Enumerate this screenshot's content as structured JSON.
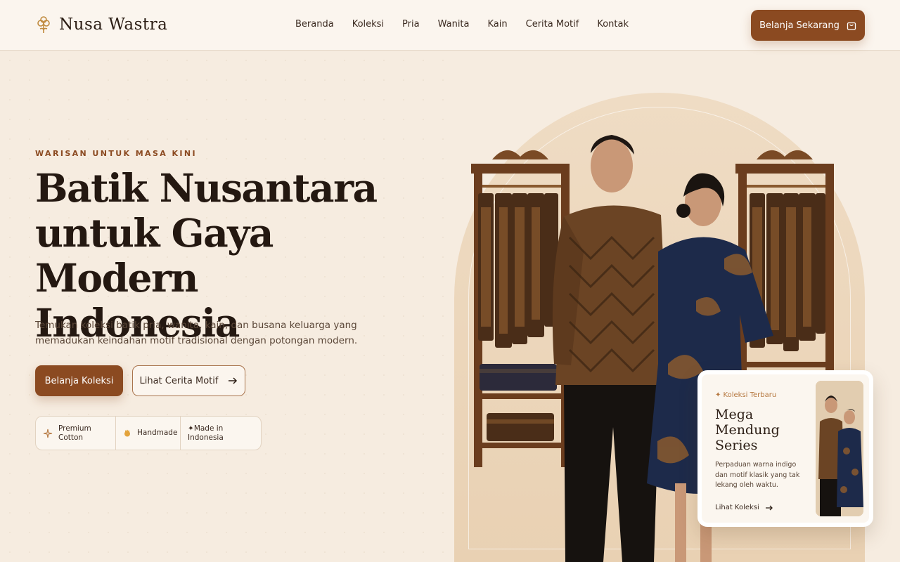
{
  "brand": {
    "name": "Nusa Wastra",
    "logo_icon": "flower-icon"
  },
  "nav": {
    "items": [
      {
        "label": "Beranda"
      },
      {
        "label": "Koleksi"
      },
      {
        "label": "Pria"
      },
      {
        "label": "Wanita"
      },
      {
        "label": "Kain"
      },
      {
        "label": "Cerita Motif"
      },
      {
        "label": "Kontak"
      }
    ]
  },
  "header": {
    "cta_label": "Belanja Sekarang",
    "cta_icon": "shopping-bag-icon"
  },
  "hero": {
    "eyebrow": "WARISAN UNTUK MASA KINI",
    "title_line1": "Batik Nusantara",
    "title_line2": "untuk Gaya Modern",
    "title_line3": "Indonesia",
    "description": "Temukan koleksi batik pria, wanita, kain, dan busana keluarga yang memadukan keindahan motif tradisional dengan potongan modern.",
    "primary_button": "Belanja Koleksi",
    "secondary_button": "Lihat Cerita Motif",
    "secondary_icon": "arrow-right-icon"
  },
  "features": [
    {
      "icon": "sparkle-icon",
      "label_line1": "Premium",
      "label_line2": "Cotton"
    },
    {
      "icon": "hand-icon",
      "label_line1": "Handmade",
      "label_line2": ""
    },
    {
      "icon": "star-icon",
      "label_line1": "Made in",
      "label_line2": "Indonesia"
    }
  ],
  "card": {
    "badge": "✦ Koleksi Terbaru",
    "title_line1": "Mega",
    "title_line2": "Mendung",
    "title_line3": "Series",
    "description": "Perpaduan warna indigo dan motif klasik yang tak lekang oleh waktu.",
    "link_label": "Lihat Koleksi"
  },
  "colors": {
    "accent": "#8b4a21",
    "background": "#f6ece0",
    "text": "#2b1d14"
  }
}
